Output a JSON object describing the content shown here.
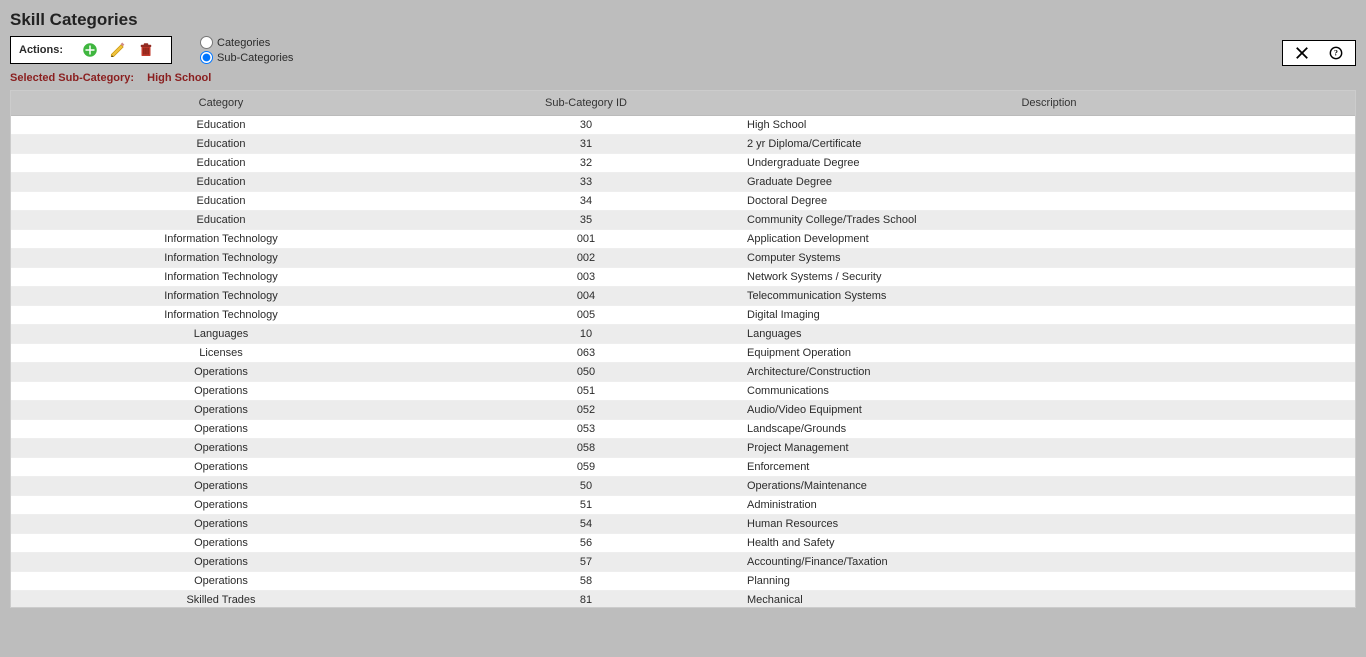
{
  "title": "Skill Categories",
  "actions": {
    "label": "Actions:"
  },
  "radios": {
    "categories": "Categories",
    "sub_categories": "Sub-Categories",
    "selected": "sub_categories"
  },
  "selected_line": {
    "label": "Selected Sub-Category:",
    "value": "High School"
  },
  "table": {
    "headers": {
      "category": "Category",
      "sub_id": "Sub-Category ID",
      "description": "Description"
    },
    "rows": [
      {
        "category": "Education",
        "sub_id": "30",
        "description": "High School"
      },
      {
        "category": "Education",
        "sub_id": "31",
        "description": "2 yr Diploma/Certificate"
      },
      {
        "category": "Education",
        "sub_id": "32",
        "description": "Undergraduate Degree"
      },
      {
        "category": "Education",
        "sub_id": "33",
        "description": "Graduate Degree"
      },
      {
        "category": "Education",
        "sub_id": "34",
        "description": "Doctoral Degree"
      },
      {
        "category": "Education",
        "sub_id": "35",
        "description": "Community College/Trades School"
      },
      {
        "category": "Information Technology",
        "sub_id": "001",
        "description": "Application Development"
      },
      {
        "category": "Information Technology",
        "sub_id": "002",
        "description": "Computer Systems"
      },
      {
        "category": "Information Technology",
        "sub_id": "003",
        "description": "Network Systems / Security"
      },
      {
        "category": "Information Technology",
        "sub_id": "004",
        "description": "Telecommunication Systems"
      },
      {
        "category": "Information Technology",
        "sub_id": "005",
        "description": "Digital Imaging"
      },
      {
        "category": "Languages",
        "sub_id": "10",
        "description": "Languages"
      },
      {
        "category": "Licenses",
        "sub_id": "063",
        "description": "Equipment Operation"
      },
      {
        "category": "Operations",
        "sub_id": "050",
        "description": "Architecture/Construction"
      },
      {
        "category": "Operations",
        "sub_id": "051",
        "description": "Communications"
      },
      {
        "category": "Operations",
        "sub_id": "052",
        "description": "Audio/Video Equipment"
      },
      {
        "category": "Operations",
        "sub_id": "053",
        "description": "Landscape/Grounds"
      },
      {
        "category": "Operations",
        "sub_id": "058",
        "description": "Project Management"
      },
      {
        "category": "Operations",
        "sub_id": "059",
        "description": "Enforcement"
      },
      {
        "category": "Operations",
        "sub_id": "50",
        "description": "Operations/Maintenance"
      },
      {
        "category": "Operations",
        "sub_id": "51",
        "description": "Administration"
      },
      {
        "category": "Operations",
        "sub_id": "54",
        "description": "Human Resources"
      },
      {
        "category": "Operations",
        "sub_id": "56",
        "description": "Health and Safety"
      },
      {
        "category": "Operations",
        "sub_id": "57",
        "description": "Accounting/Finance/Taxation"
      },
      {
        "category": "Operations",
        "sub_id": "58",
        "description": "Planning"
      },
      {
        "category": "Skilled Trades",
        "sub_id": "81",
        "description": "Mechanical"
      }
    ]
  }
}
